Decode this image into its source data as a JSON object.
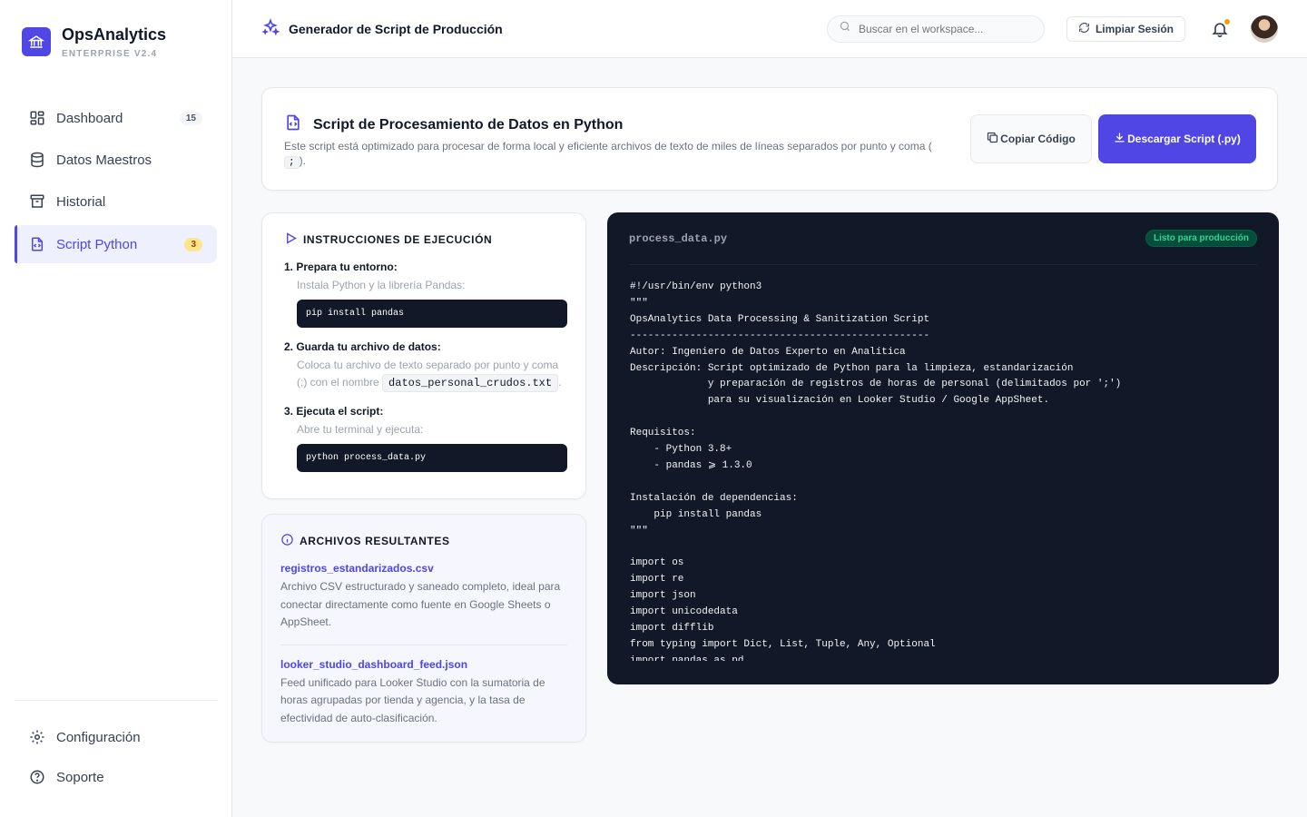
{
  "brand": {
    "name": "OpsAnalytics",
    "subtitle": "ENTERPRISE V2.4"
  },
  "sidebar": {
    "items": [
      {
        "label": "Dashboard",
        "badge": "15",
        "icon": "grid-icon"
      },
      {
        "label": "Datos Maestros",
        "badge": "",
        "icon": "database-icon"
      },
      {
        "label": "Historial",
        "badge": "",
        "icon": "archive-icon"
      },
      {
        "label": "Script Python",
        "badge": "3",
        "icon": "file-code-icon",
        "active": true
      }
    ],
    "bottom": [
      {
        "label": "Configuración",
        "icon": "gear-icon"
      },
      {
        "label": "Soporte",
        "icon": "help-circle-icon"
      }
    ]
  },
  "topbar": {
    "title": "Generador de Script de Producción",
    "search_placeholder": "Buscar en el workspace...",
    "clear_label": "Limpiar Sesión"
  },
  "header": {
    "title": "Script de Procesamiento de Datos en Python",
    "desc_pre": "Este script está optimizado para procesar de forma local y eficiente archivos de texto de miles de líneas separados por punto y coma (",
    "desc_code": ";",
    "desc_post": ").",
    "copy_label": "Copiar Código",
    "download_label": "Descargar Script (.py)"
  },
  "instructions": {
    "title": "INSTRUCCIONES DE EJECUCIÓN",
    "steps": [
      {
        "title": "1. Prepara tu entorno:",
        "desc": "Instala Python y la librería Pandas:",
        "cmd": "pip install pandas"
      },
      {
        "title": "2. Guarda tu archivo de datos:",
        "desc": "Coloca tu archivo de texto separado por punto y coma (;) con el nombre",
        "code": "datos_personal_crudos.txt",
        "suffix": "."
      },
      {
        "title": "3. Ejecuta el script:",
        "desc": "Abre tu terminal y ejecuta:",
        "cmd": "python process_data.py"
      }
    ]
  },
  "files": {
    "title": "ARCHIVOS RESULTANTES",
    "items": [
      {
        "name": "registros_estandarizados.csv",
        "desc": "Archivo CSV estructurado y saneado completo, ideal para conectar directamente como fuente en Google Sheets o AppSheet."
      },
      {
        "name": "looker_studio_dashboard_feed.json",
        "desc": "Feed unificado para Looker Studio con la sumatoria de horas agrupadas por tienda y agencia, y la tasa de efectividad de auto-clasificación."
      }
    ]
  },
  "code": {
    "filename": "process_data.py",
    "badge": "Listo para producción",
    "lines": [
      "#!/usr/bin/env python3",
      "\"\"\"",
      "OpsAnalytics Data Processing & Sanitization Script",
      "--------------------------------------------------",
      "Autor: Ingeniero de Datos Experto en Analítica",
      "Descripción: Script optimizado de Python para la limpieza, estandarización",
      "             y preparación de registros de horas de personal (delimitados por ';')",
      "             para su visualización en Looker Studio / Google AppSheet.",
      "",
      "Requisitos:",
      "    - Python 3.8+",
      "    - pandas ⩾ 1.3.0",
      "",
      "Instalación de dependencias:",
      "    pip install pandas",
      "\"\"\"",
      "",
      "import os",
      "import re",
      "import json",
      "import unicodedata",
      "import difflib",
      "from typing import Dict, List, Tuple, Any, Optional",
      "import pandas as pd"
    ]
  },
  "colors": {
    "accent": "#4f46e5",
    "code_bg": "#111827",
    "success": "#34d399",
    "notification": "#f59e0b"
  }
}
